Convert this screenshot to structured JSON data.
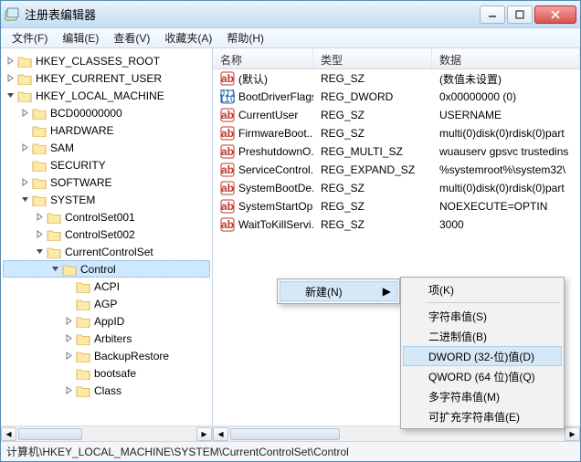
{
  "window": {
    "title": "注册表编辑器"
  },
  "menubar": [
    "文件(F)",
    "编辑(E)",
    "查看(V)",
    "收藏夹(A)",
    "帮助(H)"
  ],
  "tree": {
    "roots": [
      {
        "label": "HKEY_CLASSES_ROOT",
        "exp": "closed"
      },
      {
        "label": "HKEY_CURRENT_USER",
        "exp": "closed"
      },
      {
        "label": "HKEY_LOCAL_MACHINE",
        "exp": "open",
        "children": [
          {
            "label": "BCD00000000",
            "exp": "closed"
          },
          {
            "label": "HARDWARE",
            "exp": "none"
          },
          {
            "label": "SAM",
            "exp": "closed"
          },
          {
            "label": "SECURITY",
            "exp": "none"
          },
          {
            "label": "SOFTWARE",
            "exp": "closed"
          },
          {
            "label": "SYSTEM",
            "exp": "open",
            "children": [
              {
                "label": "ControlSet001",
                "exp": "closed"
              },
              {
                "label": "ControlSet002",
                "exp": "closed"
              },
              {
                "label": "CurrentControlSet",
                "exp": "open",
                "children": [
                  {
                    "label": "Control",
                    "exp": "open",
                    "selected": true,
                    "children": [
                      {
                        "label": "ACPI",
                        "exp": "none"
                      },
                      {
                        "label": "AGP",
                        "exp": "none"
                      },
                      {
                        "label": "AppID",
                        "exp": "closed"
                      },
                      {
                        "label": "Arbiters",
                        "exp": "closed"
                      },
                      {
                        "label": "BackupRestore",
                        "exp": "closed"
                      },
                      {
                        "label": "bootsafe",
                        "exp": "none"
                      },
                      {
                        "label": "Class",
                        "exp": "closed"
                      }
                    ]
                  }
                ]
              }
            ]
          }
        ]
      }
    ]
  },
  "list": {
    "headers": {
      "name": "名称",
      "type": "类型",
      "data": "数据"
    },
    "rows": [
      {
        "icon": "str",
        "name": "(默认)",
        "type": "REG_SZ",
        "data": "(数值未设置)"
      },
      {
        "icon": "bin",
        "name": "BootDriverFlags",
        "type": "REG_DWORD",
        "data": "0x00000000 (0)"
      },
      {
        "icon": "str",
        "name": "CurrentUser",
        "type": "REG_SZ",
        "data": "USERNAME"
      },
      {
        "icon": "str",
        "name": "FirmwareBoot...",
        "type": "REG_SZ",
        "data": "multi(0)disk(0)rdisk(0)part"
      },
      {
        "icon": "str",
        "name": "PreshutdownO...",
        "type": "REG_MULTI_SZ",
        "data": "wuauserv gpsvc trustedins"
      },
      {
        "icon": "str",
        "name": "ServiceControl...",
        "type": "REG_EXPAND_SZ",
        "data": "%systemroot%\\system32\\"
      },
      {
        "icon": "str",
        "name": "SystemBootDe...",
        "type": "REG_SZ",
        "data": "multi(0)disk(0)rdisk(0)part"
      },
      {
        "icon": "str",
        "name": "SystemStartOp...",
        "type": "REG_SZ",
        "data": " NOEXECUTE=OPTIN"
      },
      {
        "icon": "str",
        "name": "WaitToKillServi...",
        "type": "REG_SZ",
        "data": "3000"
      }
    ]
  },
  "context1": {
    "new": "新建(N)"
  },
  "context2": {
    "items": [
      {
        "label": "项(K)",
        "sep_after": true
      },
      {
        "label": "字符串值(S)"
      },
      {
        "label": "二进制值(B)"
      },
      {
        "label": "DWORD (32-位)值(D)",
        "hl": true
      },
      {
        "label": "QWORD (64 位)值(Q)"
      },
      {
        "label": "多字符串值(M)"
      },
      {
        "label": "可扩充字符串值(E)"
      }
    ]
  },
  "statusbar": "计算机\\HKEY_LOCAL_MACHINE\\SYSTEM\\CurrentControlSet\\Control"
}
